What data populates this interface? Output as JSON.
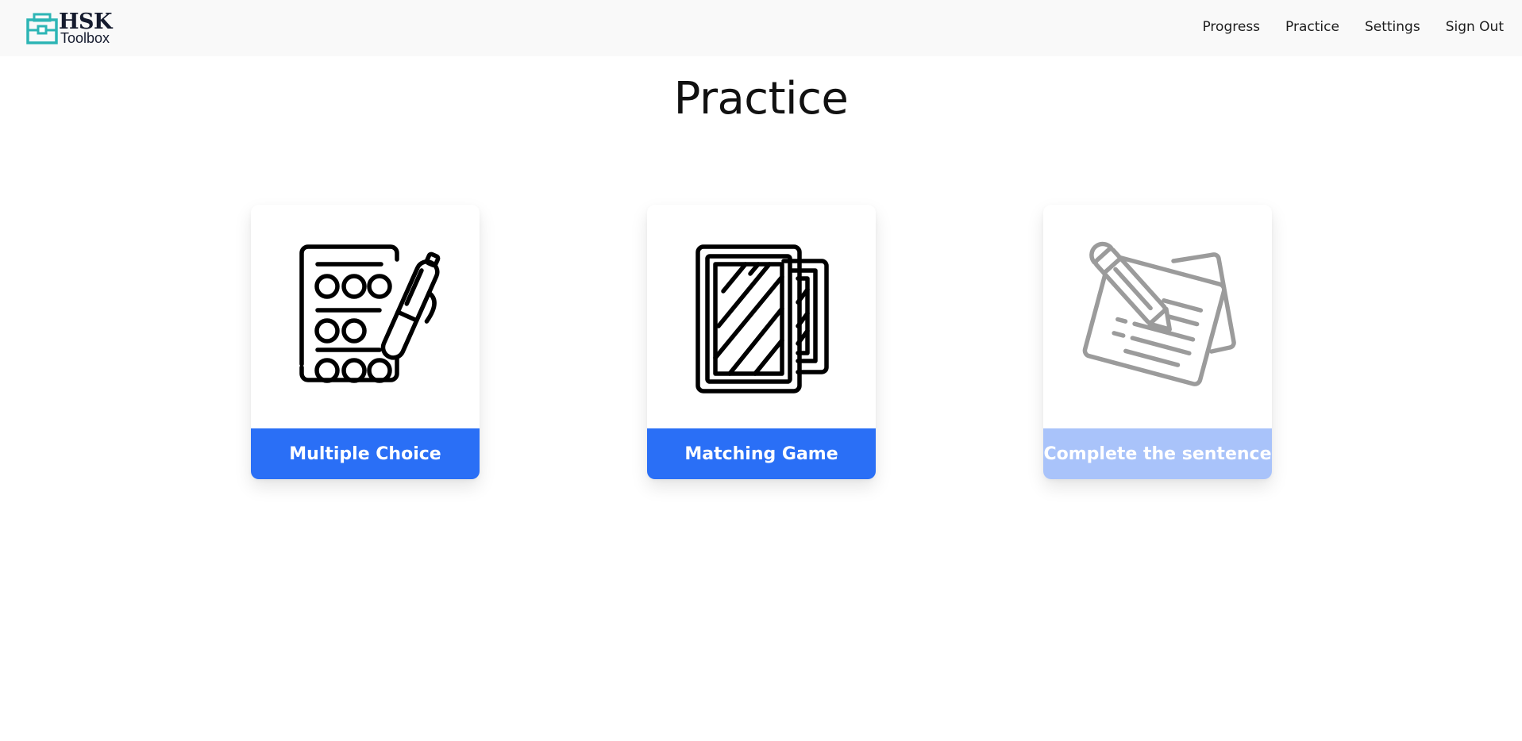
{
  "brand": {
    "line1": "HSK",
    "line2": "Toolbox",
    "icon": "toolbox-icon",
    "accent": "#2db5b5"
  },
  "nav": {
    "progress": "Progress",
    "practice": "Practice",
    "settings": "Settings",
    "sign_out": "Sign Out"
  },
  "page": {
    "title": "Practice"
  },
  "cards": [
    {
      "label": "Multiple Choice",
      "icon": "multiple-choice-sheet-icon",
      "enabled": true
    },
    {
      "label": "Matching Game",
      "icon": "cards-icon",
      "enabled": true
    },
    {
      "label": "Complete the sentence",
      "icon": "notes-pencil-icon",
      "enabled": false
    }
  ],
  "colors": {
    "button": "#2a6ff6",
    "button_disabled": "#a9c3fa",
    "navbar_bg": "#f9f9f9"
  }
}
